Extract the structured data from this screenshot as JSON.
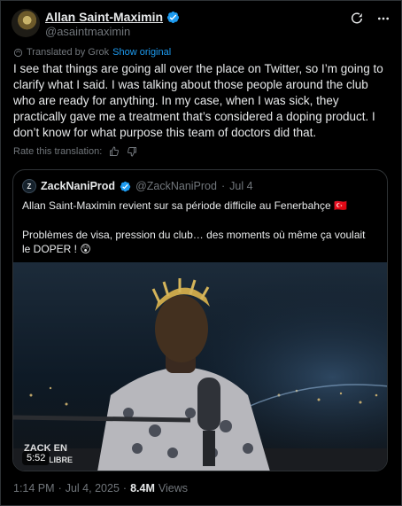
{
  "author": {
    "name": "Allan Saint-Maximin",
    "handle": "@asaintmaximin"
  },
  "translation": {
    "label": "Translated by Grok",
    "show_original": "Show original"
  },
  "tweet_text": "I see that things are going all over the place on Twitter, so I’m going to clarify what I said. I was talking about those people around the club who are ready for anything. In my case, when I was sick, they practically gave me a treatment that’s considered a doping product. I don’t know for what purpose this team of doctors did that.",
  "rate_label": "Rate this translation:",
  "quote": {
    "name": "ZackNaniProd",
    "handle": "@ZackNaniProd",
    "separator": "·",
    "date": "Jul 4",
    "line1": "Allan Saint-Maximin revient sur sa période difficile au Fenerbahçe 🇹🇷",
    "line2": "Problèmes de visa, pression du club… des moments où même ça voulait le DOPER ! 😲",
    "video_duration": "5:52",
    "video_logo_top": "ZACK EN",
    "video_logo_bottom": "LIBRE"
  },
  "footer": {
    "time": "1:14 PM",
    "dot1": "·",
    "date": "Jul 4, 2025",
    "dot2": "·",
    "views_count": "8.4M",
    "views_label": "Views"
  },
  "colors": {
    "accent": "#1d9bf0",
    "muted": "#71767b",
    "border": "#2f3336"
  }
}
